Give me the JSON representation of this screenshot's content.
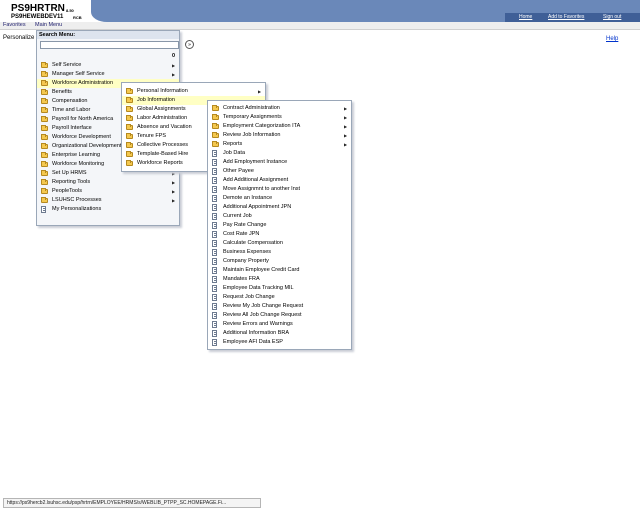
{
  "header": {
    "title": "PS9HRTRN",
    "version": "8.50",
    "db": "PS9HEWEBDEV11",
    "tag": "RCB",
    "links": [
      "Home",
      "Add to Favorites",
      "Sign out"
    ]
  },
  "menubar": {
    "favorites": "Favorites",
    "main_menu": "Main Menu"
  },
  "page": {
    "personalize": "Personalize",
    "help": "Help"
  },
  "search_menu": {
    "title": "Search Menu:",
    "placeholder": "",
    "go": "»",
    "count": "0"
  },
  "main_menu_items": [
    {
      "label": "Self Service",
      "icon": "folder-icon",
      "arrow": true
    },
    {
      "label": "Manager Self Service",
      "icon": "folder-icon",
      "arrow": true
    },
    {
      "label": "Workforce Administration",
      "icon": "folder-icon",
      "arrow": true,
      "selected": true
    },
    {
      "label": "Benefits",
      "icon": "folder-icon",
      "arrow": false
    },
    {
      "label": "Compensation",
      "icon": "folder-icon",
      "arrow": false
    },
    {
      "label": "Time and Labor",
      "icon": "folder-icon",
      "arrow": false
    },
    {
      "label": "Payroll for North America",
      "icon": "folder-icon",
      "arrow": false
    },
    {
      "label": "Payroll Interface",
      "icon": "folder-icon",
      "arrow": false
    },
    {
      "label": "Workforce Development",
      "icon": "folder-icon",
      "arrow": false
    },
    {
      "label": "Organizational Development",
      "icon": "folder-icon",
      "arrow": false
    },
    {
      "label": "Enterprise Learning",
      "icon": "folder-icon",
      "arrow": false
    },
    {
      "label": "Workforce Monitoring",
      "icon": "folder-icon",
      "arrow": false
    },
    {
      "label": "Set Up HRMS",
      "icon": "folder-icon",
      "arrow": true
    },
    {
      "label": "Reporting Tools",
      "icon": "folder-icon",
      "arrow": true
    },
    {
      "label": "PeopleTools",
      "icon": "folder-icon",
      "arrow": true
    },
    {
      "label": "LSUHSC Processes",
      "icon": "folder-icon",
      "arrow": true
    },
    {
      "label": "My Personalizations",
      "icon": "document-icon",
      "arrow": false
    }
  ],
  "workforce_admin_items": [
    {
      "label": "Personal Information",
      "icon": "folder-icon",
      "arrow": true
    },
    {
      "label": "Job Information",
      "icon": "folder-icon",
      "arrow": false,
      "selected": true
    },
    {
      "label": "Global Assignments",
      "icon": "folder-icon",
      "arrow": false
    },
    {
      "label": "Labor Administration",
      "icon": "folder-icon",
      "arrow": false
    },
    {
      "label": "Absence and Vacation",
      "icon": "folder-icon",
      "arrow": false
    },
    {
      "label": "Tenure FPS",
      "icon": "folder-icon",
      "arrow": false
    },
    {
      "label": "Collective Processes",
      "icon": "folder-icon",
      "arrow": false
    },
    {
      "label": "Template-Based Hire",
      "icon": "folder-icon",
      "arrow": false
    },
    {
      "label": "Workforce Reports",
      "icon": "folder-icon",
      "arrow": false
    }
  ],
  "job_info_items": [
    {
      "label": "Contract Administration",
      "icon": "folder-icon",
      "arrow": true
    },
    {
      "label": "Temporary Assignments",
      "icon": "folder-icon",
      "arrow": true
    },
    {
      "label": "Employment Categorization ITA",
      "icon": "folder-icon",
      "arrow": true
    },
    {
      "label": "Review Job Information",
      "icon": "folder-icon",
      "arrow": true
    },
    {
      "label": "Reports",
      "icon": "folder-icon",
      "arrow": true
    },
    {
      "label": "Job Data",
      "icon": "document-icon",
      "arrow": false
    },
    {
      "label": "Add Employment Instance",
      "icon": "document-icon",
      "arrow": false
    },
    {
      "label": "Other Payee",
      "icon": "document-icon",
      "arrow": false
    },
    {
      "label": "Add Additional Assignment",
      "icon": "document-icon",
      "arrow": false
    },
    {
      "label": "Move Assignmnt to another Inst",
      "icon": "document-icon",
      "arrow": false
    },
    {
      "label": "Demote an Instance",
      "icon": "document-icon",
      "arrow": false
    },
    {
      "label": "Additional Appointment JPN",
      "icon": "document-icon",
      "arrow": false
    },
    {
      "label": "Current Job",
      "icon": "document-icon",
      "arrow": false
    },
    {
      "label": "Pay Rate Change",
      "icon": "document-icon",
      "arrow": false
    },
    {
      "label": "Cost Rate JPN",
      "icon": "document-icon",
      "arrow": false
    },
    {
      "label": "Calculate Compensation",
      "icon": "document-icon",
      "arrow": false
    },
    {
      "label": "Business Expenses",
      "icon": "document-icon",
      "arrow": false
    },
    {
      "label": "Company Property",
      "icon": "document-icon",
      "arrow": false
    },
    {
      "label": "Maintain Employee Credit Card",
      "icon": "document-icon",
      "arrow": false
    },
    {
      "label": "Mandates FRA",
      "icon": "document-icon",
      "arrow": false
    },
    {
      "label": "Employee Data Tracking MIL",
      "icon": "document-icon",
      "arrow": false
    },
    {
      "label": "Request Job Change",
      "icon": "document-icon",
      "arrow": false
    },
    {
      "label": "Review My Job Change Request",
      "icon": "document-icon",
      "arrow": false
    },
    {
      "label": "Review All Job Change Request",
      "icon": "document-icon",
      "arrow": false
    },
    {
      "label": "Review Errors and Warnings",
      "icon": "document-icon",
      "arrow": false
    },
    {
      "label": "Additional Information BRA",
      "icon": "document-icon",
      "arrow": false
    },
    {
      "label": "Employee AFI Data ESP",
      "icon": "document-icon",
      "arrow": false
    }
  ],
  "statusbar": {
    "url": "https://ps9hercb2.lsuhsc.edu/psp/hrtrn/EMPLOYEE/HRMS/s/WEBLIB_PTPP_SC.HOMEPAGE.Fi..."
  },
  "colors": {
    "header_blue": "#6a88b9",
    "header_dark": "#3f5f97",
    "highlight": "#ffffc4",
    "folder": "#f4c84f"
  }
}
